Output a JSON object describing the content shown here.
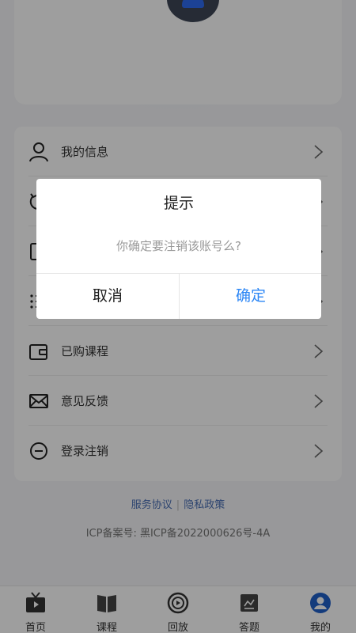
{
  "menu": {
    "items": [
      {
        "label": "我的信息",
        "icon": "user-icon"
      },
      {
        "label": "",
        "icon": "history-icon"
      },
      {
        "label": "",
        "icon": "document-icon"
      },
      {
        "label": "",
        "icon": "list-icon"
      },
      {
        "label": "已购课程",
        "icon": "wallet-icon"
      },
      {
        "label": "意见反馈",
        "icon": "mail-icon"
      },
      {
        "label": "登录注销",
        "icon": "minus-circle-icon"
      }
    ]
  },
  "footer": {
    "service_agreement": "服务协议",
    "separator": "|",
    "privacy_policy": "隐私政策",
    "icp": "ICP备案号: 黑ICP备2022000626号-4A"
  },
  "tabbar": {
    "items": [
      {
        "label": "首页",
        "icon": "tv-icon"
      },
      {
        "label": "课程",
        "icon": "book-icon"
      },
      {
        "label": "回放",
        "icon": "replay-icon"
      },
      {
        "label": "答题",
        "icon": "quiz-icon"
      },
      {
        "label": "我的",
        "icon": "profile-icon",
        "active": true
      }
    ]
  },
  "dialog": {
    "title": "提示",
    "message": "你确定要注销该账号么?",
    "cancel_label": "取消",
    "confirm_label": "确定"
  },
  "colors": {
    "accent": "#2b86f5",
    "link": "#4a6fb5"
  }
}
